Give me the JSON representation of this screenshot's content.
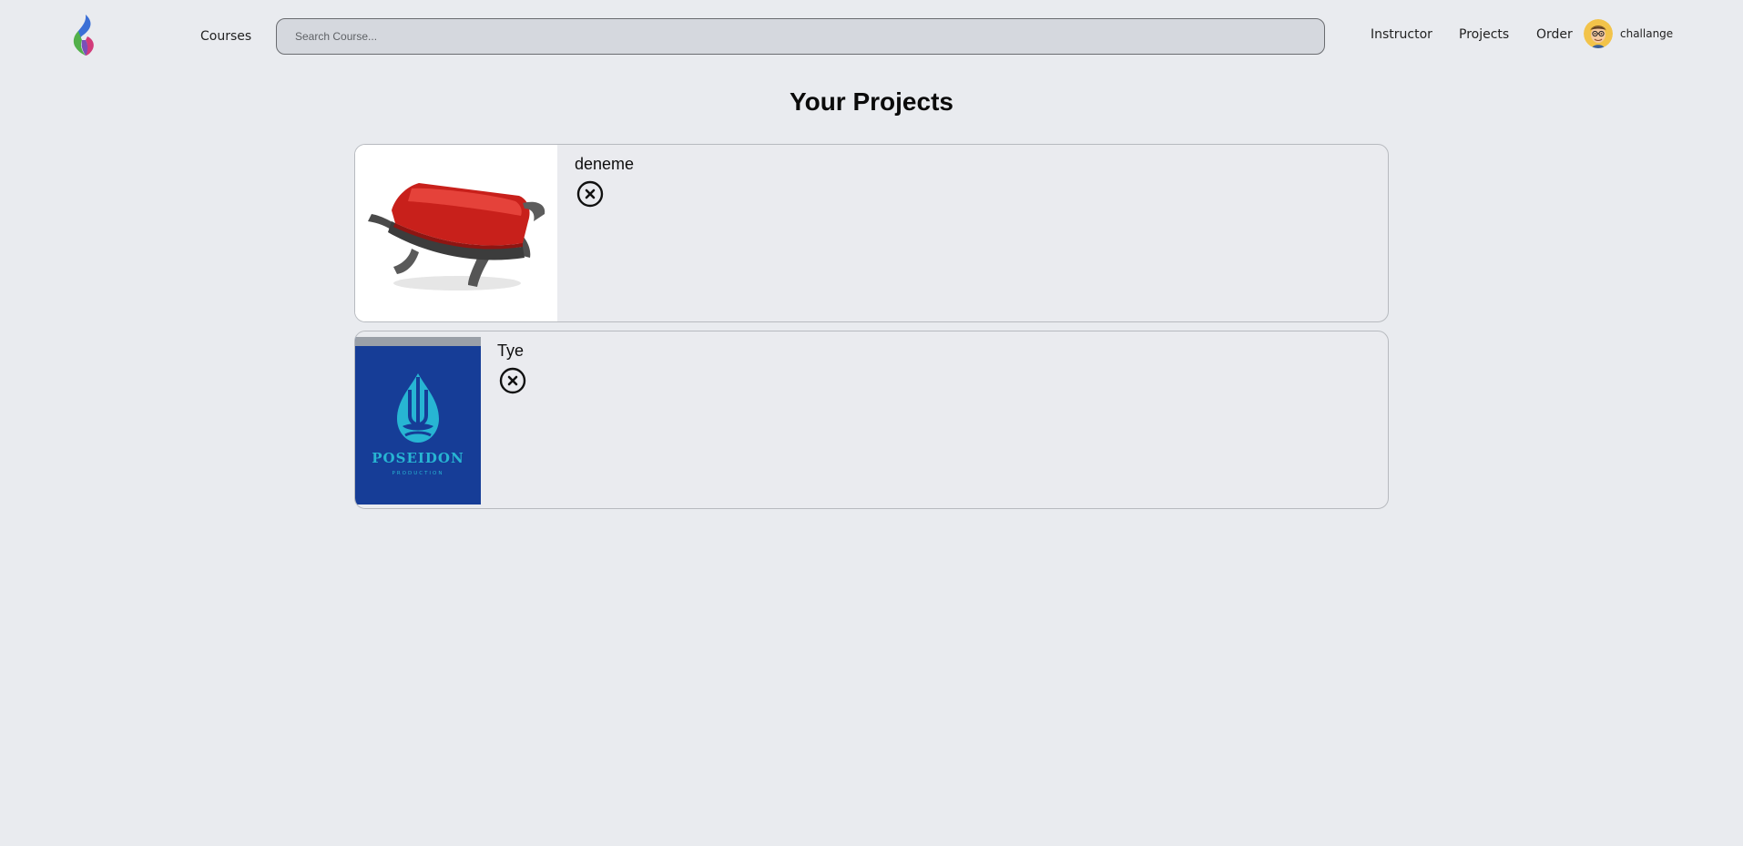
{
  "nav": {
    "logo_icon": "flame-logo-icon",
    "courses_label": "Courses",
    "search_placeholder": "Search Course...",
    "instructor_label": "Instructor",
    "projects_label": "Projects",
    "order_label": "Order",
    "avatar_icon": "user-avatar-icon",
    "username": "challange"
  },
  "main": {
    "title": "Your Projects",
    "projects": [
      {
        "name": "deneme",
        "image": "red-grill-product-image",
        "remove_icon": "circle-x-icon"
      },
      {
        "name": "Tye",
        "image": "poseidon-production-logo-image",
        "remove_icon": "circle-x-icon"
      }
    ]
  },
  "colors": {
    "background": "#e9ebef",
    "search_background": "#d5d8de",
    "card_border": "#b7babf",
    "poseidon_blue": "#163d97",
    "poseidon_teal": "#27b5d3",
    "grill_red": "#c8201b"
  }
}
